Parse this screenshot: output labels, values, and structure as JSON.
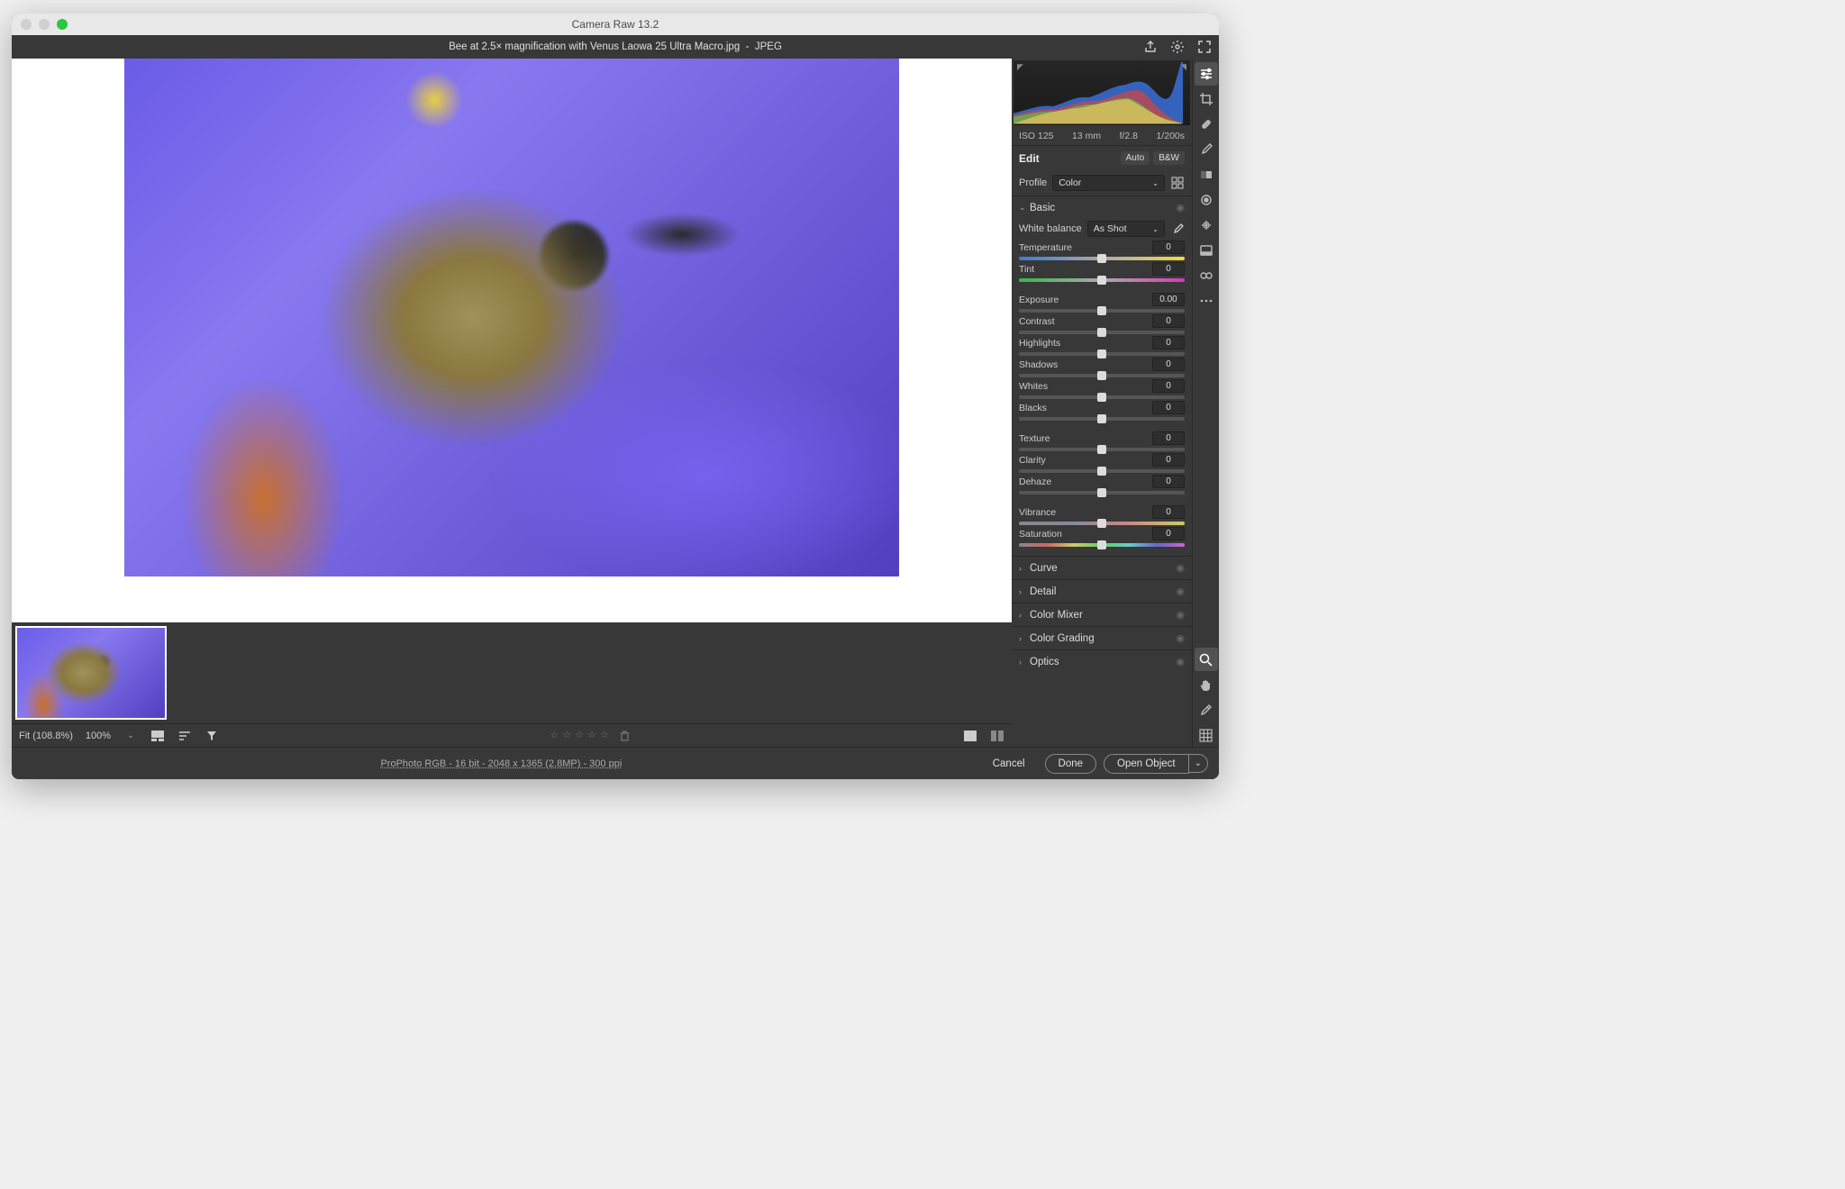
{
  "app": {
    "title": "Camera Raw 13.2"
  },
  "file": {
    "name": "Bee at 2.5× magnification with Venus Laowa 25 Ultra Macro.jpg",
    "format": "JPEG"
  },
  "meta": {
    "iso": "ISO 125",
    "focal": "13 mm",
    "aperture": "f/2.8",
    "shutter": "1/200s"
  },
  "edit": {
    "header": "Edit",
    "auto": "Auto",
    "bw": "B&W",
    "profile_label": "Profile",
    "profile_value": "Color"
  },
  "basic": {
    "title": "Basic",
    "wb_label": "White balance",
    "wb_value": "As Shot",
    "sliders": {
      "temperature": {
        "label": "Temperature",
        "value": "0"
      },
      "tint": {
        "label": "Tint",
        "value": "0"
      },
      "exposure": {
        "label": "Exposure",
        "value": "0.00"
      },
      "contrast": {
        "label": "Contrast",
        "value": "0"
      },
      "highlights": {
        "label": "Highlights",
        "value": "0"
      },
      "shadows": {
        "label": "Shadows",
        "value": "0"
      },
      "whites": {
        "label": "Whites",
        "value": "0"
      },
      "blacks": {
        "label": "Blacks",
        "value": "0"
      },
      "texture": {
        "label": "Texture",
        "value": "0"
      },
      "clarity": {
        "label": "Clarity",
        "value": "0"
      },
      "dehaze": {
        "label": "Dehaze",
        "value": "0"
      },
      "vibrance": {
        "label": "Vibrance",
        "value": "0"
      },
      "saturation": {
        "label": "Saturation",
        "value": "0"
      }
    }
  },
  "sections": {
    "curve": "Curve",
    "detail": "Detail",
    "color_mixer": "Color Mixer",
    "color_grading": "Color Grading",
    "optics": "Optics"
  },
  "bottom": {
    "fit": "Fit (108.8%)",
    "zoom": "100%"
  },
  "footer": {
    "meta": "ProPhoto RGB - 16 bit - 2048 x 1365 (2.8MP) - 300 ppi",
    "cancel": "Cancel",
    "done": "Done",
    "open": "Open Object"
  }
}
